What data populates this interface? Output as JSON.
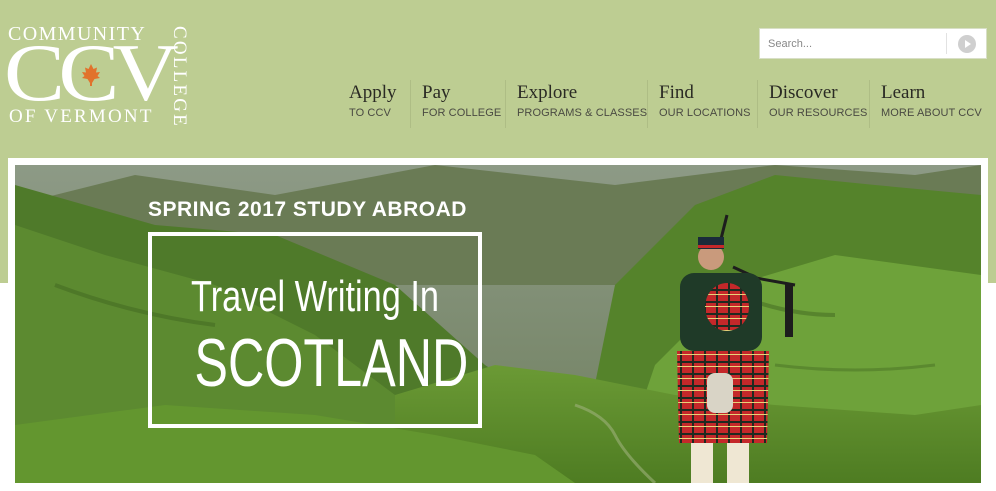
{
  "logo": {
    "top_word": "COMMUNITY",
    "side_word": "COLLEGE",
    "initials": "CCV",
    "bottom_word": "OF VERMONT",
    "leaf_color": "#e1722c"
  },
  "search": {
    "placeholder": "Search...",
    "button_icon": "play-arrow-icon"
  },
  "nav": {
    "items": [
      {
        "main": "Apply",
        "sub": "TO CCV"
      },
      {
        "main": "Pay",
        "sub": "FOR COLLEGE"
      },
      {
        "main": "Explore",
        "sub": "PROGRAMS & CLASSES"
      },
      {
        "main": "Find",
        "sub": "OUR LOCATIONS"
      },
      {
        "main": "Discover",
        "sub": "OUR RESOURCES"
      },
      {
        "main": "Learn",
        "sub": "MORE ABOUT CCV"
      }
    ]
  },
  "hero": {
    "kicker": "SPRING 2017 STUDY ABROAD",
    "title_line1": "Travel Writing In",
    "title_line2": "SCOTLAND"
  },
  "colors": {
    "header_bg": "#bdcd92",
    "text_dark": "#2a2a24",
    "white": "#ffffff"
  }
}
